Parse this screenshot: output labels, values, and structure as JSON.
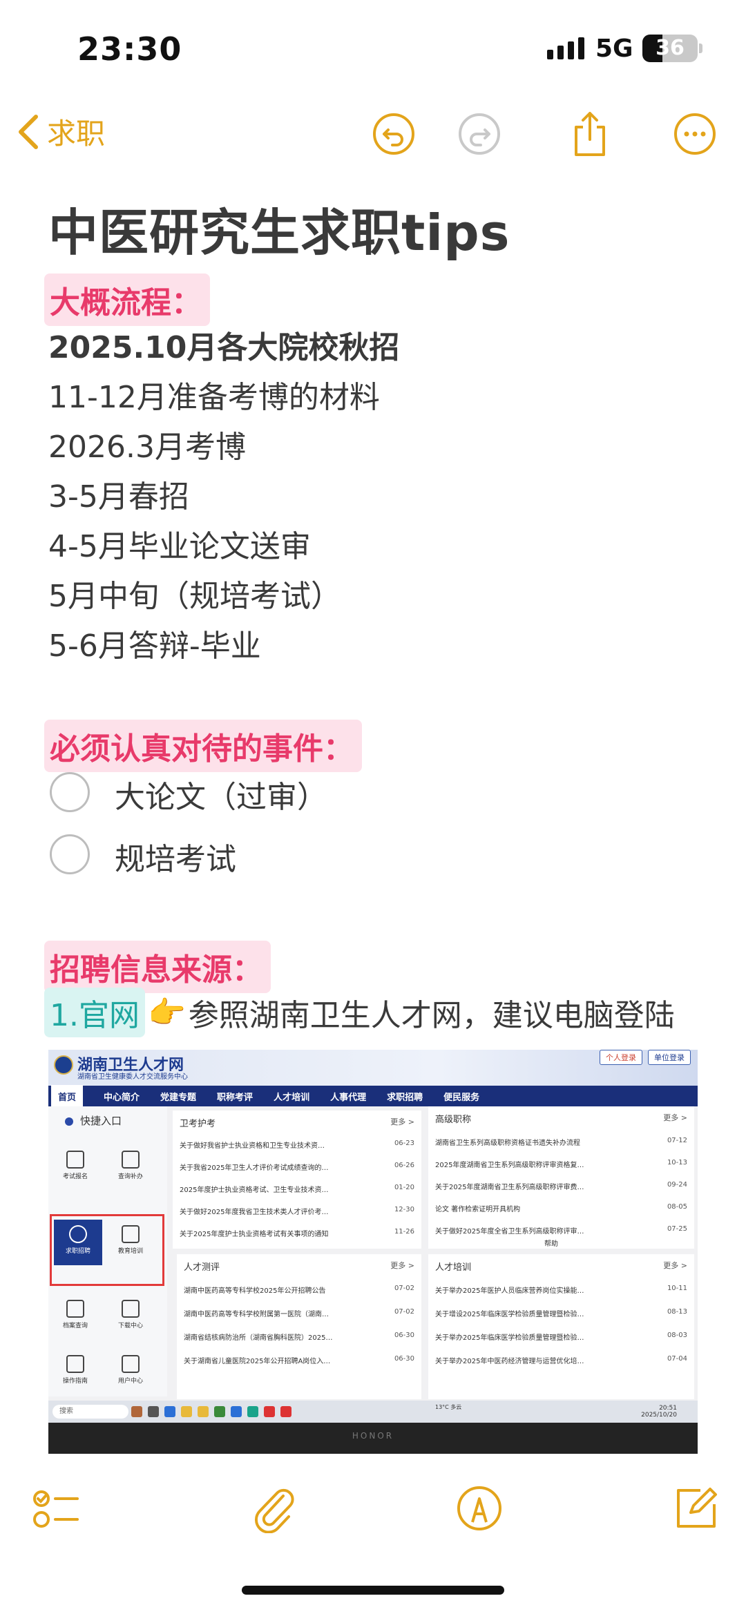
{
  "status": {
    "time": "23:30",
    "network": "5G",
    "battery": "36",
    "battery_level": 0.36
  },
  "nav": {
    "back_label": "求职",
    "icons": [
      "undo-icon",
      "redo-icon",
      "share-icon",
      "more-icon"
    ]
  },
  "note": {
    "title": "中医研究生求职tips",
    "section1": {
      "heading": "大概流程：",
      "lines": [
        "2025.10月各大院校秋招",
        "11-12月准备考博的材料",
        "2026.3月考博",
        "3-5月春招",
        "4-5月毕业论文送审",
        "5月中旬（规培考试）",
        "5-6月答辩-毕业"
      ]
    },
    "section2": {
      "heading": "必须认真对待的事件：",
      "items": [
        {
          "label": "大论文（过审）",
          "checked": false
        },
        {
          "label": "规培考试",
          "checked": false
        }
      ]
    },
    "section3": {
      "heading": "招聘信息来源：",
      "tag": "1.官网",
      "emoji": "👉",
      "text": "参照湖南卫生人才网，建议电脑登陆"
    }
  },
  "screenshot": {
    "site_title": "湖南卫生人才网",
    "site_subtitle": "湖南省卫生健康委人才交流服务中心",
    "login_buttons": [
      "个人登录",
      "单位登录"
    ],
    "menu": [
      "首页",
      "中心简介",
      "党建专题",
      "职称考评",
      "人才培训",
      "人事代理",
      "求职招聘",
      "便民服务"
    ],
    "quick_entry": "快捷入口",
    "tiles": [
      "考试报名",
      "查询补办",
      "求职招聘",
      "教育培训",
      "档案查询",
      "下载中心",
      "操作指南",
      "用户中心"
    ],
    "more": "更多 >",
    "help": "帮助",
    "panels": [
      {
        "title": "卫考护考",
        "rows": [
          {
            "text": "关于做好我省护士执业资格和卫生专业技术资…",
            "date": "06-23"
          },
          {
            "text": "关于我省2025年卫生人才评价考试成绩查询的…",
            "date": "06-26"
          },
          {
            "text": "2025年度护士执业资格考试、卫生专业技术资…",
            "date": "01-20"
          },
          {
            "text": "关于做好2025年度我省卫生技术类人才评价考…",
            "date": "12-30"
          },
          {
            "text": "关于2025年度护士执业资格考试有关事项的通知",
            "date": "11-26"
          }
        ]
      },
      {
        "title": "高级职称",
        "rows": [
          {
            "text": "湖南省卫生系列高级职称资格证书遗失补办流程",
            "date": "07-12"
          },
          {
            "text": "2025年度湖南省卫生系列高级职称评审资格复…",
            "date": "10-13"
          },
          {
            "text": "关于2025年度湖南省卫生系列高级职称评审费…",
            "date": "09-24"
          },
          {
            "text": "论文 著作检索证明开具机构",
            "date": "08-05"
          },
          {
            "text": "关于做好2025年度全省卫生系列高级职称评审…",
            "date": "07-25"
          }
        ]
      },
      {
        "title": "人才测评",
        "rows": [
          {
            "text": "湖南中医药高等专科学校2025年公开招聘公告",
            "date": "07-02"
          },
          {
            "text": "湖南中医药高等专科学校附属第一医院（湖南…",
            "date": "07-02"
          },
          {
            "text": "湖南省结核病防治所（湖南省胸科医院）2025…",
            "date": "06-30"
          },
          {
            "text": "关于湖南省儿童医院2025年公开招聘A岗位入…",
            "date": "06-30"
          }
        ]
      },
      {
        "title": "人才培训",
        "rows": [
          {
            "text": "关于举办2025年医护人员临床营养岗位实操能…",
            "date": "10-11"
          },
          {
            "text": "关于增设2025年临床医学检验质量管理暨检验…",
            "date": "08-13"
          },
          {
            "text": "关于举办2025年临床医学检验质量管理暨检验…",
            "date": "08-03"
          },
          {
            "text": "关于举办2025年中医药经济管理与运营优化培…",
            "date": "07-04"
          }
        ]
      }
    ],
    "taskbar_search": "搜索",
    "weather": "13°C 多云",
    "clock_time": "20:51",
    "clock_date": "2025/10/20",
    "brand": "HONOR"
  },
  "toolbar": {
    "icons": [
      "checklist-icon",
      "attachment-icon",
      "markup-icon",
      "compose-icon"
    ]
  },
  "colors": {
    "accent": "#e3a41b",
    "heading_pink": "#e83a6a",
    "highlight_pink": "#fde1ea",
    "teal": "#1fa7a0"
  }
}
